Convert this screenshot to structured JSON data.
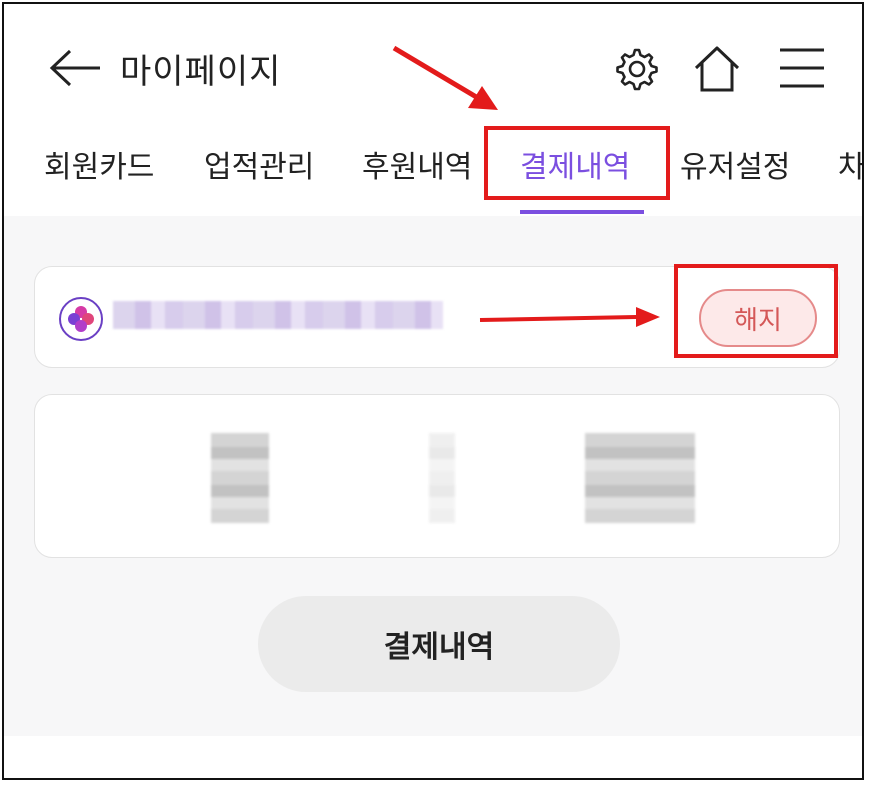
{
  "header": {
    "title": "마이페이지",
    "icons": [
      "back-arrow-icon",
      "gear-icon",
      "home-icon",
      "menu-icon"
    ]
  },
  "tabs": [
    {
      "label": "회원카드",
      "active": false
    },
    {
      "label": "업적관리",
      "active": false
    },
    {
      "label": "후원내역",
      "active": false
    },
    {
      "label": "결제내역",
      "active": true
    },
    {
      "label": "유저설정",
      "active": false
    },
    {
      "label": "차",
      "active": false
    }
  ],
  "subscription_card": {
    "cancel_button_label": "해지"
  },
  "payment_history_button_label": "결제내역",
  "colors": {
    "accent": "#7b4fe0",
    "annotation_red": "#e31b1b",
    "cancel_pill_text": "#d45858",
    "cancel_pill_bg": "#fde9e9"
  }
}
